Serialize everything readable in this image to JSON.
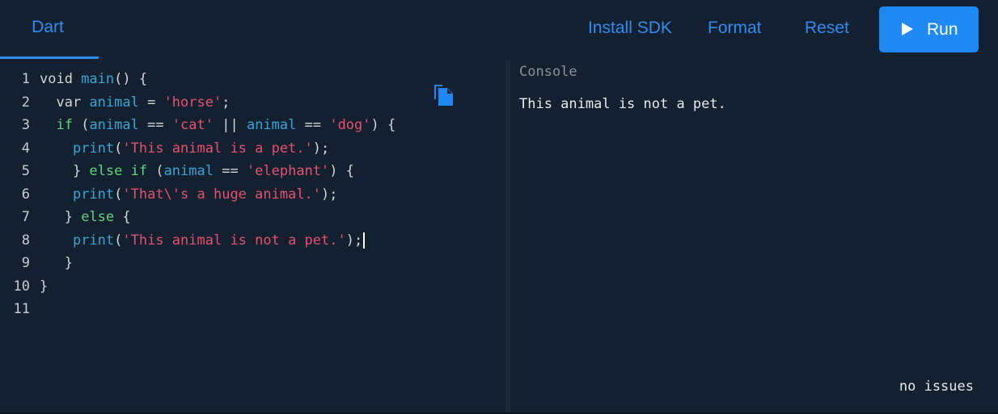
{
  "header": {
    "tab_label": "Dart",
    "install_sdk_label": "Install SDK",
    "format_label": "Format",
    "reset_label": "Reset",
    "run_label": "Run"
  },
  "editor": {
    "lines": [
      {
        "number": "1",
        "tokens": [
          {
            "t": "void ",
            "c": "kw"
          },
          {
            "t": "main",
            "c": "fn"
          },
          {
            "t": "() {",
            "c": "p"
          }
        ]
      },
      {
        "number": "2",
        "tokens": [
          {
            "t": "  var ",
            "c": "kw"
          },
          {
            "t": "animal",
            "c": "var"
          },
          {
            "t": " = ",
            "c": "p"
          },
          {
            "t": "'horse'",
            "c": "str"
          },
          {
            "t": ";",
            "c": "p"
          }
        ]
      },
      {
        "number": "3",
        "tokens": [
          {
            "t": "  if",
            "c": "ctl"
          },
          {
            "t": " (",
            "c": "p"
          },
          {
            "t": "animal",
            "c": "var"
          },
          {
            "t": " == ",
            "c": "p"
          },
          {
            "t": "'cat'",
            "c": "str"
          },
          {
            "t": " || ",
            "c": "p"
          },
          {
            "t": "animal",
            "c": "var"
          },
          {
            "t": " == ",
            "c": "p"
          },
          {
            "t": "'dog'",
            "c": "str"
          },
          {
            "t": ") {",
            "c": "p"
          }
        ]
      },
      {
        "number": "4",
        "tokens": [
          {
            "t": "    ",
            "c": "p"
          },
          {
            "t": "print",
            "c": "fn"
          },
          {
            "t": "(",
            "c": "p"
          },
          {
            "t": "'This animal is a pet.'",
            "c": "str"
          },
          {
            "t": ");",
            "c": "p"
          }
        ]
      },
      {
        "number": "5",
        "tokens": [
          {
            "t": "    } ",
            "c": "p"
          },
          {
            "t": "else if",
            "c": "ctl"
          },
          {
            "t": " (",
            "c": "p"
          },
          {
            "t": "animal",
            "c": "var"
          },
          {
            "t": " == ",
            "c": "p"
          },
          {
            "t": "'elephant'",
            "c": "str"
          },
          {
            "t": ") {",
            "c": "p"
          }
        ]
      },
      {
        "number": "6",
        "tokens": [
          {
            "t": "    ",
            "c": "p"
          },
          {
            "t": "print",
            "c": "fn"
          },
          {
            "t": "(",
            "c": "p"
          },
          {
            "t": "'That\\'s a huge animal.'",
            "c": "str"
          },
          {
            "t": ");",
            "c": "p"
          }
        ]
      },
      {
        "number": "7",
        "tokens": [
          {
            "t": "   } ",
            "c": "p"
          },
          {
            "t": "else",
            "c": "ctl"
          },
          {
            "t": " {",
            "c": "p"
          }
        ]
      },
      {
        "number": "8",
        "tokens": [
          {
            "t": "    ",
            "c": "p"
          },
          {
            "t": "print",
            "c": "fn"
          },
          {
            "t": "(",
            "c": "p"
          },
          {
            "t": "'This animal is not a pet.'",
            "c": "str"
          },
          {
            "t": ");",
            "c": "p"
          }
        ],
        "cursor": true
      },
      {
        "number": "9",
        "tokens": [
          {
            "t": "   }",
            "c": "p"
          }
        ]
      },
      {
        "number": "10",
        "tokens": [
          {
            "t": "}",
            "c": "p"
          }
        ]
      },
      {
        "number": "11",
        "tokens": []
      }
    ],
    "copy_icon": "copy-icon"
  },
  "console": {
    "title": "Console",
    "output": "This animal is not a pet.",
    "status": "no issues"
  },
  "colors": {
    "background": "#12202f",
    "accent": "#2f8cf0",
    "run_button": "#1e88f5",
    "string": "#e8506e",
    "identifier": "#36a6d6",
    "control": "#5fd67a"
  }
}
